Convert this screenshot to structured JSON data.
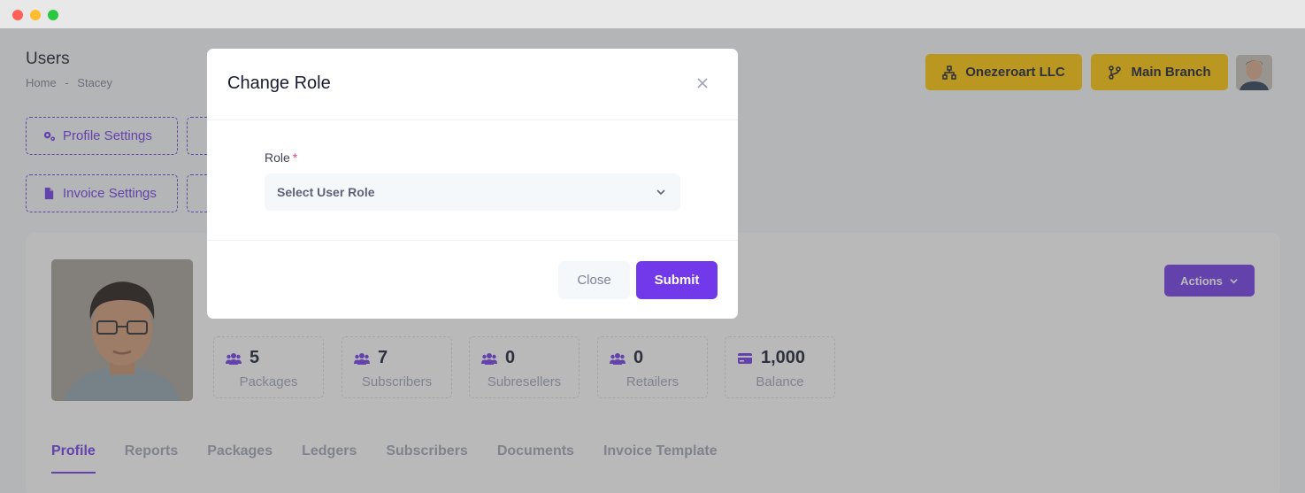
{
  "window": {
    "controls": [
      "close",
      "minimize",
      "maximize"
    ]
  },
  "header": {
    "title": "Users",
    "breadcrumb": [
      "Home",
      "-",
      "Stacey"
    ],
    "company_button": "Onezeroart LLC",
    "branch_button": "Main Branch"
  },
  "tiles": {
    "profile_settings": "Profile Settings",
    "invoice_settings": "Invoice Settings"
  },
  "profile": {
    "actions_label": "Actions",
    "stats": [
      {
        "value": "5",
        "label": "Packages",
        "icon": "users-icon"
      },
      {
        "value": "7",
        "label": "Subscribers",
        "icon": "users-icon"
      },
      {
        "value": "0",
        "label": "Subresellers",
        "icon": "users-icon"
      },
      {
        "value": "0",
        "label": "Retailers",
        "icon": "users-icon"
      },
      {
        "value": "1,000",
        "label": "Balance",
        "icon": "credit-card-icon"
      }
    ],
    "tabs": [
      "Profile",
      "Reports",
      "Packages",
      "Ledgers",
      "Subscribers",
      "Documents",
      "Invoice Template"
    ],
    "active_tab": "Profile"
  },
  "modal": {
    "title": "Change Role",
    "field_label": "Role",
    "required_mark": "*",
    "select_value": "Select User Role",
    "close_label": "Close",
    "submit_label": "Submit"
  },
  "colors": {
    "accent": "#7239ea",
    "warning": "#ffc700",
    "overlay": "rgba(80,80,80,0.4)"
  }
}
